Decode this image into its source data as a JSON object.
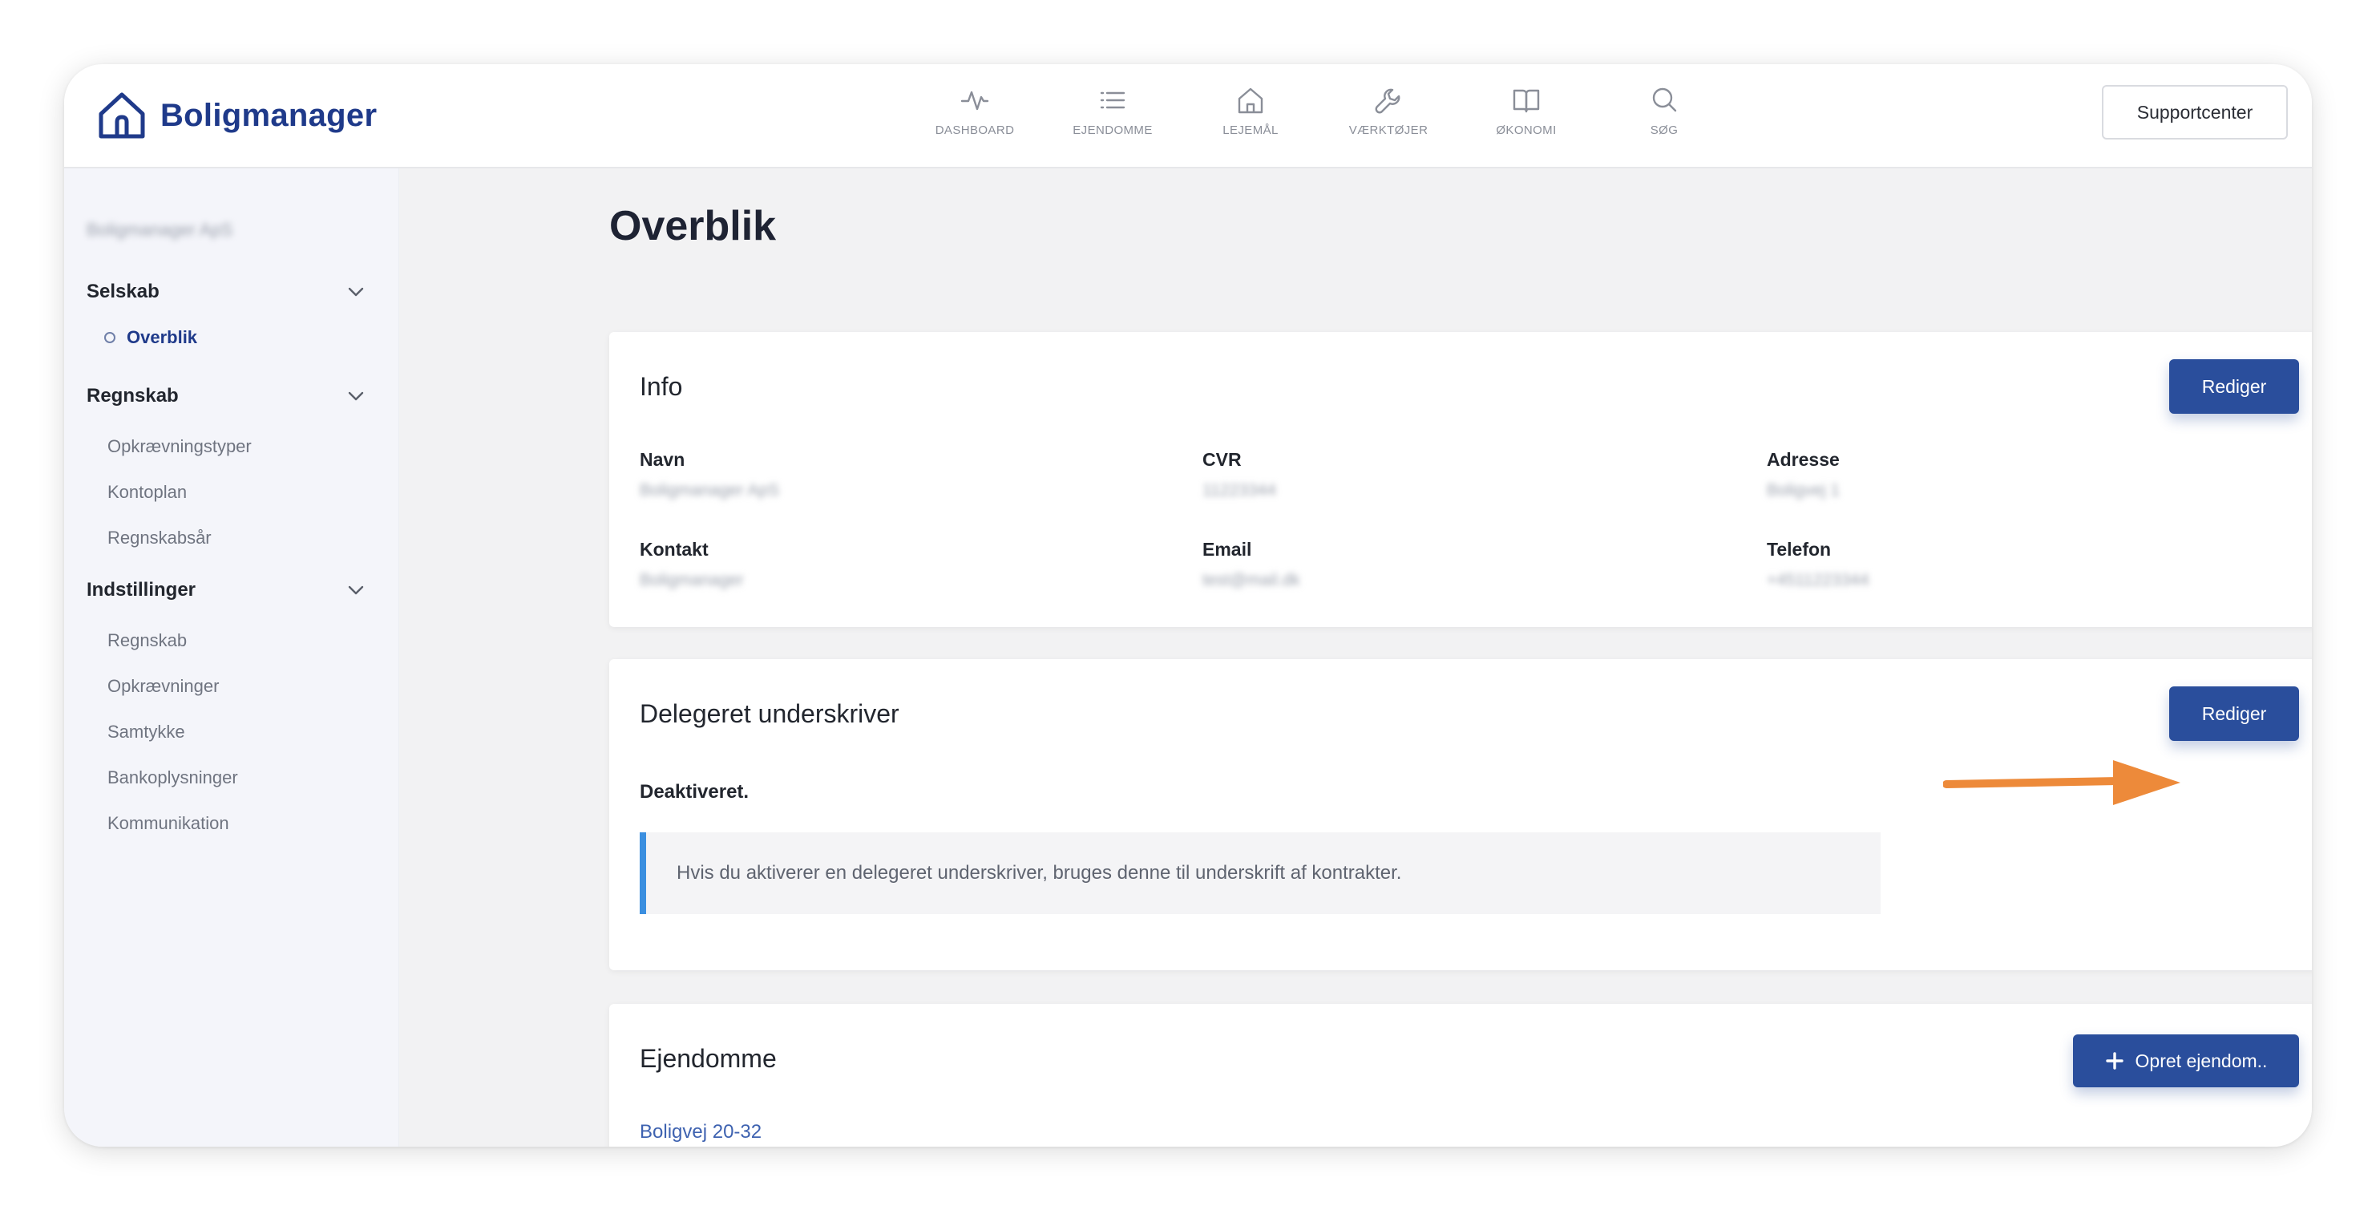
{
  "brand": {
    "name": "Boligmanager",
    "color": "#1f3a8a"
  },
  "nav": [
    {
      "label": "DASHBOARD",
      "icon": "activity-icon"
    },
    {
      "label": "EJENDOMME",
      "icon": "list-icon"
    },
    {
      "label": "LEJEMÅL",
      "icon": "home-icon"
    },
    {
      "label": "VÆRKTØJER",
      "icon": "wrench-icon"
    },
    {
      "label": "ØKONOMI",
      "icon": "book-icon"
    },
    {
      "label": "SØG",
      "icon": "search-icon"
    }
  ],
  "header": {
    "support_label": "Supportcenter"
  },
  "sidebar": {
    "company_name": "Boligmanager ApS",
    "groups": [
      {
        "title": "Selskab",
        "items": [
          "Overblik"
        ],
        "active_item": "Overblik"
      },
      {
        "title": "Regnskab",
        "items": [
          "Opkrævningstyper",
          "Kontoplan",
          "Regnskabsår"
        ]
      },
      {
        "title": "Indstillinger",
        "items": [
          "Regnskab",
          "Opkrævninger",
          "Samtykke",
          "Bankoplysninger",
          "Kommunikation"
        ]
      }
    ]
  },
  "main": {
    "title": "Overblik",
    "info": {
      "title": "Info",
      "edit_label": "Rediger",
      "fields": [
        {
          "label": "Navn",
          "value": "Boligmanager ApS"
        },
        {
          "label": "CVR",
          "value": "11223344"
        },
        {
          "label": "Adresse",
          "value": "Boligvej 1"
        },
        {
          "label": "Kontakt",
          "value": "Boligmanager"
        },
        {
          "label": "Email",
          "value": "test@mail.dk"
        },
        {
          "label": "Telefon",
          "value": "+4511223344"
        }
      ]
    },
    "delegated": {
      "title": "Delegeret underskriver",
      "edit_label": "Rediger",
      "status": "Deaktiveret.",
      "note": "Hvis du aktiverer en delegeret underskriver, bruges denne til underskrift af kontrakter."
    },
    "properties": {
      "title": "Ejendomme",
      "create_label": "Opret ejendom..",
      "items": [
        "Boligvej 20-32"
      ]
    }
  },
  "colors": {
    "primary_button": "#2a4e9c",
    "note_accent": "#3b8fe0",
    "arrow": "#ed8a3a",
    "link": "#3e62b0"
  }
}
